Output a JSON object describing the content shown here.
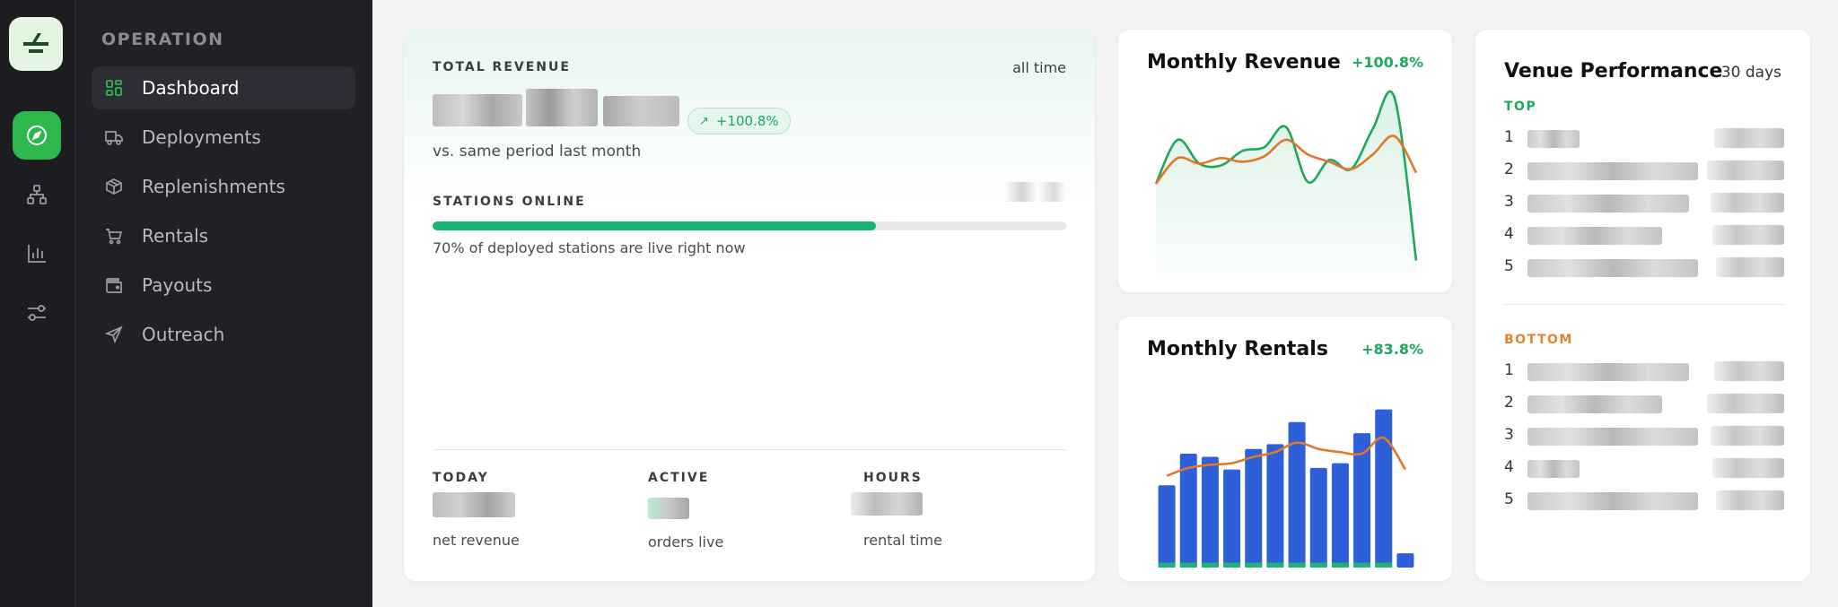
{
  "nav": {
    "section_label": "OPERATION",
    "items": [
      {
        "label": "Dashboard",
        "icon": "grid-icon",
        "active": true
      },
      {
        "label": "Deployments",
        "icon": "truck-icon",
        "active": false
      },
      {
        "label": "Replenishments",
        "icon": "box-icon",
        "active": false
      },
      {
        "label": "Rentals",
        "icon": "cart-icon",
        "active": false
      },
      {
        "label": "Payouts",
        "icon": "wallet-icon",
        "active": false
      },
      {
        "label": "Outreach",
        "icon": "send-icon",
        "active": false
      }
    ]
  },
  "rail": {
    "items": [
      "compass-icon",
      "org-chart-icon",
      "bar-chart-icon",
      "sliders-icon"
    ]
  },
  "revenue_card": {
    "title": "TOTAL REVENUE",
    "period": "all time",
    "delta": "+100.8%",
    "comparison": "vs. same period last month",
    "stations_label": "STATIONS ONLINE",
    "stations_fraction": 0.7,
    "stations_caption": "70% of deployed stations are live right now",
    "stats": [
      {
        "label": "TODAY",
        "caption": "net revenue"
      },
      {
        "label": "ACTIVE",
        "caption": "orders live"
      },
      {
        "label": "HOURS",
        "caption": "rental time"
      }
    ]
  },
  "monthly_revenue": {
    "title": "Monthly Revenue",
    "delta": "+100.8%"
  },
  "monthly_rentals": {
    "title": "Monthly Rentals",
    "delta": "+83.8%"
  },
  "venue": {
    "title": "Venue Performance",
    "period": "30 days",
    "top_label": "TOP",
    "bottom_label": "BOTTOM",
    "top_ranks": [
      "1",
      "2",
      "3",
      "4",
      "5"
    ],
    "bottom_ranks": [
      "1",
      "2",
      "3",
      "4",
      "5"
    ]
  },
  "colors": {
    "accent_green": "#1ea85e",
    "bar_blue": "#2d5fd8",
    "line_orange": "#e2772a",
    "bottom_orange": "#e2832f",
    "progress_green": "#14b472"
  },
  "chart_data": [
    {
      "type": "area",
      "title": "Monthly Revenue",
      "x": [
        1,
        2,
        3,
        4,
        5,
        6,
        7,
        8,
        9,
        10,
        11,
        12,
        13
      ],
      "series": [
        {
          "values": [
            52,
            76,
            63,
            62,
            70,
            72,
            83,
            53,
            65,
            60,
            82,
            99,
            10
          ]
        },
        {
          "values": [
            52,
            66,
            63,
            66,
            64,
            67,
            76,
            68,
            64,
            60,
            68,
            78,
            58
          ]
        }
      ],
      "ylim": [
        0,
        100
      ],
      "grid": false
    },
    {
      "type": "bar",
      "title": "Monthly Rentals",
      "x": [
        1,
        2,
        3,
        4,
        5,
        6,
        7,
        8,
        9,
        10,
        11,
        12
      ],
      "series": [
        {
          "values": [
            52,
            72,
            70,
            62,
            75,
            78,
            92,
            63,
            66,
            85,
            100,
            9
          ]
        },
        {
          "values": [
            2,
            2,
            2,
            2,
            2,
            2,
            2,
            2,
            2,
            2,
            2,
            0
          ]
        }
      ],
      "trend": [
        58,
        63,
        65,
        66,
        70,
        73,
        79,
        75,
        73,
        72,
        82,
        62
      ],
      "ylim": [
        0,
        110
      ],
      "grid": false
    }
  ]
}
